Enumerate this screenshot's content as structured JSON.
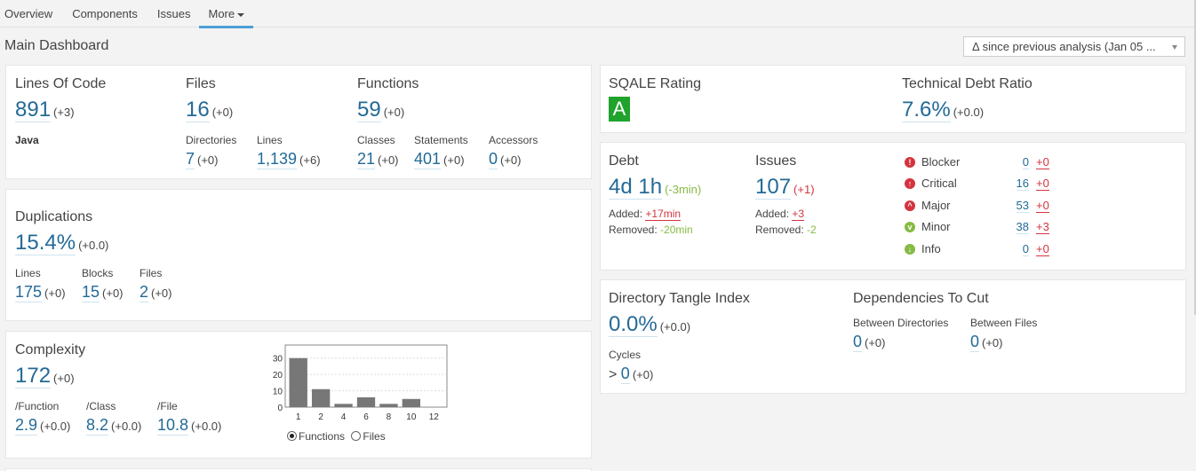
{
  "nav": {
    "tabs": [
      {
        "label": "Overview"
      },
      {
        "label": "Components"
      },
      {
        "label": "Issues"
      },
      {
        "label": "More",
        "active": true
      }
    ]
  },
  "header": {
    "title": "Main Dashboard",
    "period_select": "Δ since previous analysis (Jan 05 ..."
  },
  "size": {
    "loc_title": "Lines Of Code",
    "loc_value": "891",
    "loc_delta": "(+3)",
    "language": "Java",
    "files_title": "Files",
    "files_value": "16",
    "files_delta": "(+0)",
    "directories_label": "Directories",
    "directories_value": "7",
    "directories_delta": "(+0)",
    "lines_label": "Lines",
    "lines_value": "1,139",
    "lines_delta": "(+6)",
    "functions_title": "Functions",
    "functions_value": "59",
    "functions_delta": "(+0)",
    "classes_label": "Classes",
    "classes_value": "21",
    "classes_delta": "(+0)",
    "statements_label": "Statements",
    "statements_value": "401",
    "statements_delta": "(+0)",
    "accessors_label": "Accessors",
    "accessors_value": "0",
    "accessors_delta": "(+0)"
  },
  "duplications": {
    "title": "Duplications",
    "value": "15.4%",
    "delta": "(+0.0)",
    "lines_label": "Lines",
    "lines_value": "175",
    "lines_delta": "(+0)",
    "blocks_label": "Blocks",
    "blocks_value": "15",
    "blocks_delta": "(+0)",
    "files_label": "Files",
    "files_value": "2",
    "files_delta": "(+0)"
  },
  "complexity": {
    "title": "Complexity",
    "value": "172",
    "delta": "(+0)",
    "per_function_label": "/Function",
    "per_function_value": "2.9",
    "per_function_delta": "(+0.0)",
    "per_class_label": "/Class",
    "per_class_value": "8.2",
    "per_class_delta": "(+0.0)",
    "per_file_label": "/File",
    "per_file_value": "10.8",
    "per_file_delta": "(+0.0)",
    "radio_functions": "Functions",
    "radio_files": "Files"
  },
  "chart_data": {
    "type": "bar",
    "title": "",
    "xlabel": "",
    "ylabel": "",
    "categories": [
      "1",
      "2",
      "4",
      "6",
      "8",
      "10",
      "12"
    ],
    "values": [
      30,
      11,
      2,
      6,
      2,
      5,
      0
    ],
    "yticks": [
      "0",
      "10",
      "20",
      "30"
    ],
    "ylim": [
      0,
      38
    ],
    "grid": true,
    "bar_color": "#777777"
  },
  "sqale": {
    "rating_title": "SQALE Rating",
    "rating_value": "A",
    "rating_color": "#1fa32d",
    "ratio_title": "Technical Debt Ratio",
    "ratio_value": "7.6%",
    "ratio_delta": "(+0.0)"
  },
  "debt": {
    "title": "Debt",
    "value": "4d 1h",
    "delta": "(-3min)",
    "added_label": "Added:",
    "added_value": "+17min",
    "removed_label": "Removed:",
    "removed_value": "-20min"
  },
  "issues": {
    "title": "Issues",
    "value": "107",
    "delta": "(+1)",
    "added_label": "Added:",
    "added_value": "+3",
    "removed_label": "Removed:",
    "removed_value": "-2",
    "severities": [
      {
        "label": "Blocker",
        "icon": "blocker-icon",
        "glyph": "!",
        "color": "#d4333f",
        "count": "0",
        "delta": "+0"
      },
      {
        "label": "Critical",
        "icon": "critical-icon",
        "glyph": "↑",
        "color": "#d4333f",
        "count": "16",
        "delta": "+0"
      },
      {
        "label": "Major",
        "icon": "major-icon",
        "glyph": "^",
        "color": "#d4333f",
        "count": "53",
        "delta": "+0"
      },
      {
        "label": "Minor",
        "icon": "minor-icon",
        "glyph": "v",
        "color": "#85bb43",
        "count": "38",
        "delta": "+3"
      },
      {
        "label": "Info",
        "icon": "info-icon",
        "glyph": "↓",
        "color": "#85bb43",
        "count": "0",
        "delta": "+0"
      }
    ]
  },
  "design": {
    "tangle_title": "Directory Tangle Index",
    "tangle_value": "0.0%",
    "tangle_delta": "(+0.0)",
    "cycles_label": "Cycles",
    "cycles_prefix": ">",
    "cycles_value": "0",
    "cycles_delta": "(+0)",
    "deps_title": "Dependencies To Cut",
    "between_dirs_label": "Between Directories",
    "between_dirs_value": "0",
    "between_dirs_delta": "(+0)",
    "between_files_label": "Between Files",
    "between_files_value": "0",
    "between_files_delta": "(+0)"
  }
}
